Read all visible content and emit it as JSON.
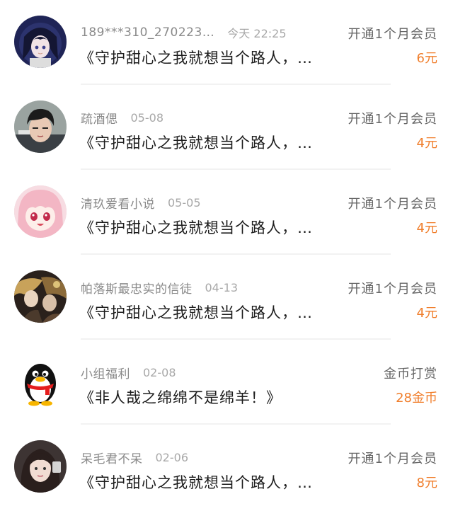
{
  "rows": [
    {
      "username": "189***310_270223…",
      "time": "今天 22:25",
      "title": "《守护甜心之我就想当个路人，…",
      "action": "开通1个月会员",
      "amount": "6元",
      "avatar_icon": "anime-girl-dark-hair-avatar-icon"
    },
    {
      "username": "疏酒偲",
      "time": "05-08",
      "title": "《守护甜心之我就想当个路人，…",
      "action": "开通1个月会员",
      "amount": "4元",
      "avatar_icon": "boy-photo-avatar-icon"
    },
    {
      "username": "清玖爱看小说",
      "time": "05-05",
      "title": "《守护甜心之我就想当个路人，…",
      "action": "开通1个月会员",
      "amount": "4元",
      "avatar_icon": "anime-girl-pink-avatar-icon"
    },
    {
      "username": "帕落斯最忠实的信徒",
      "time": "04-13",
      "title": "《守护甜心之我就想当个路人，…",
      "action": "开通1个月会员",
      "amount": "4元",
      "avatar_icon": "anime-characters-avatar-icon"
    },
    {
      "username": "小组福利",
      "time": "02-08",
      "title": "《非人哉之绵绵不是绵羊！》",
      "action": "金币打赏",
      "amount": "28金币",
      "avatar_icon": "penguin-avatar-icon"
    },
    {
      "username": "呆毛君不呆",
      "time": "02-06",
      "title": "《守护甜心之我就想当个路人，…",
      "action": "开通1个月会员",
      "amount": "8元",
      "avatar_icon": "girl-photo-avatar-icon"
    }
  ],
  "colors": {
    "amount": "#f07d2a",
    "username": "#8a8a8a",
    "title": "#1d1d1d"
  }
}
